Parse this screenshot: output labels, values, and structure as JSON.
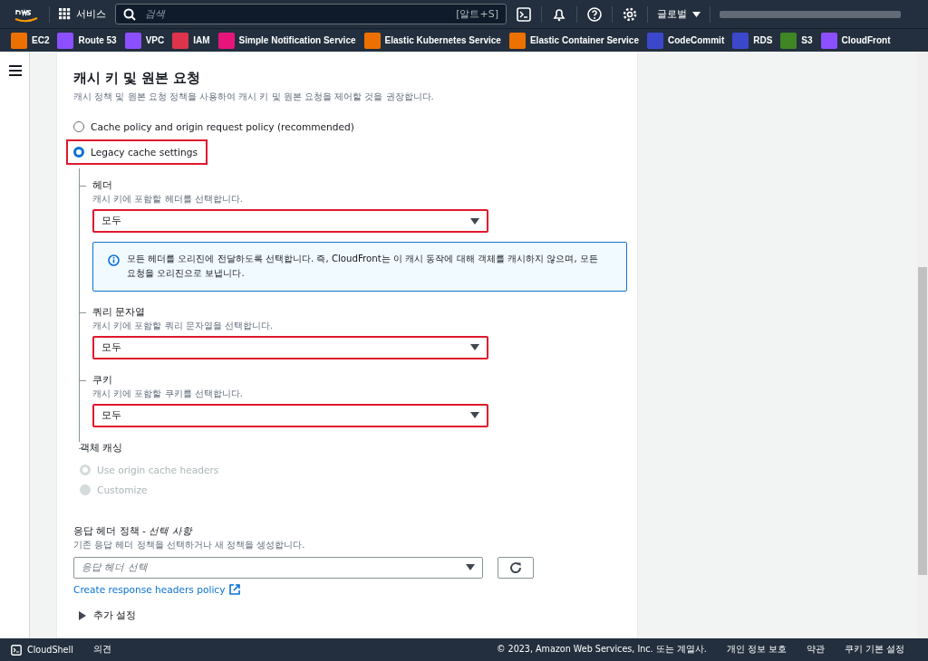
{
  "top_nav": {
    "services_label": "서비스",
    "search": {
      "placeholder": "검색",
      "shortcut": "[알트+S]"
    },
    "region": "글로벌"
  },
  "favorites": [
    {
      "label": "EC2",
      "color": "#ed7100"
    },
    {
      "label": "Route 53",
      "color": "#8c4fff"
    },
    {
      "label": "VPC",
      "color": "#8c4fff"
    },
    {
      "label": "IAM",
      "color": "#dd344c"
    },
    {
      "label": "Simple Notification Service",
      "color": "#e7157b"
    },
    {
      "label": "Elastic Kubernetes Service",
      "color": "#ed7100"
    },
    {
      "label": "Elastic Container Service",
      "color": "#ed7100"
    },
    {
      "label": "CodeCommit",
      "color": "#3b48cc"
    },
    {
      "label": "RDS",
      "color": "#3b48cc"
    },
    {
      "label": "S3",
      "color": "#3f8624"
    },
    {
      "label": "CloudFront",
      "color": "#8c4fff"
    }
  ],
  "section": {
    "title": "캐시 키 및 원본 요청",
    "description": "캐시 정책 및 원본 요청 정책을 사용하여 캐시 키 및 원본 요청을 제어할 것을 권장합니다.",
    "options": [
      {
        "label": "Cache policy and origin request policy (recommended)",
        "selected": false,
        "highlighted": false
      },
      {
        "label": "Legacy cache settings",
        "selected": true,
        "highlighted": true
      }
    ],
    "settings": [
      {
        "kind": "select",
        "label": "헤더",
        "description": "캐시 키에 포함할 헤더를 선택합니다.",
        "value": "모두",
        "highlighted": true,
        "info": "모든 헤더를 오리진에 전달하도록 선택합니다. 즉, CloudFront는 이 캐시 동작에 대해 객체를 캐시하지 않으며, 모든 요청을 오리진으로 보냅니다."
      },
      {
        "kind": "select",
        "label": "쿼리 문자열",
        "description": "캐시 키에 포함할 쿼리 문자열을 선택합니다.",
        "value": "모두",
        "highlighted": true
      },
      {
        "kind": "select",
        "label": "쿠키",
        "description": "캐시 키에 포함할 쿠키를 선택합니다.",
        "value": "모두",
        "highlighted": true
      },
      {
        "kind": "radio",
        "label": "객체 캐싱",
        "options": [
          {
            "label": "Use origin cache headers",
            "selected": true,
            "disabled": true
          },
          {
            "label": "Customize",
            "selected": false,
            "disabled": true
          }
        ]
      }
    ]
  },
  "response_headers": {
    "label": "응답 헤더 정책 - *선택 사항*",
    "description": "기존 응답 헤더 정책을 선택하거나 새 정책을 생성합니다.",
    "placeholder": "응답 헤더 선택",
    "link": "Create response headers policy"
  },
  "additional_settings": {
    "label": "추가 설정",
    "expanded": false
  },
  "footer": {
    "left": [
      "CloudShell",
      "의견"
    ],
    "copyright": "© 2023, Amazon Web Services, Inc. 또는 계열사.",
    "links": [
      "개인 정보 보호",
      "약관",
      "쿠키 기본 설정"
    ]
  }
}
